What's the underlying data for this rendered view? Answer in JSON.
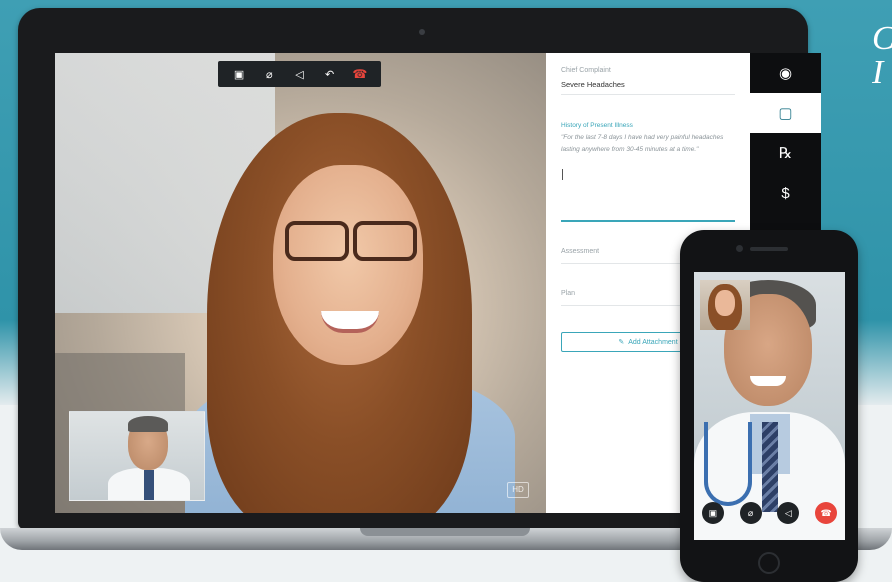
{
  "overlay": {
    "corner_text": "C\nI"
  },
  "video": {
    "hd_label": "HD"
  },
  "call_controls": [
    {
      "icon": "video-camera-icon",
      "glyph": "▣"
    },
    {
      "icon": "mute-mic-icon",
      "glyph": "⌀"
    },
    {
      "icon": "mute-speaker-icon",
      "glyph": "◁"
    },
    {
      "icon": "share-icon",
      "glyph": "↶"
    },
    {
      "icon": "end-call-icon",
      "glyph": "☎"
    }
  ],
  "notes": {
    "chief_complaint_label": "Chief Complaint",
    "chief_complaint_value": "Severe Headaches",
    "hpi_label": "History of Present Illness",
    "hpi_text": "\"For the last 7-8 days I have had very painful headaches lasting anywhere from 30-45 minutes at a time.\"",
    "assessment_label": "Assessment",
    "plan_label": "Plan",
    "attach_label": "Add Attachment"
  },
  "sidebar": {
    "items": [
      {
        "icon": "user-icon",
        "glyph": "◉",
        "active": false
      },
      {
        "icon": "clipboard-icon",
        "glyph": "▢",
        "active": true
      },
      {
        "icon": "prescription-icon",
        "glyph": "℞",
        "active": false
      },
      {
        "icon": "billing-icon",
        "glyph": "$",
        "active": false
      }
    ]
  },
  "phone_controls": [
    {
      "icon": "video-camera-icon",
      "glyph": "▣"
    },
    {
      "icon": "mute-mic-icon",
      "glyph": "⌀"
    },
    {
      "icon": "mute-speaker-icon",
      "glyph": "◁"
    },
    {
      "icon": "end-call-icon",
      "glyph": "☎"
    }
  ],
  "colors": {
    "accent": "#3aa6b9",
    "end_call": "#e8453c"
  }
}
